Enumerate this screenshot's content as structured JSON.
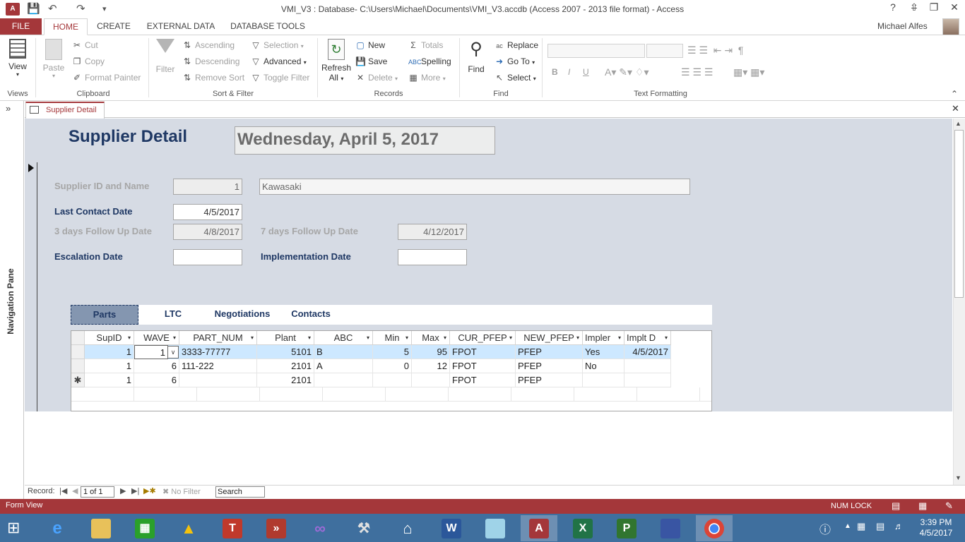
{
  "window": {
    "title": "VMI_V3 : Database- C:\\Users\\Michael\\Documents\\VMI_V3.accdb (Access 2007 - 2013 file format) - Access",
    "help": "?",
    "user": "Michael Alfes"
  },
  "tabs": {
    "file": "FILE",
    "home": "HOME",
    "create": "CREATE",
    "external": "EXTERNAL DATA",
    "dbtools": "DATABASE TOOLS"
  },
  "ribbon": {
    "views": {
      "view": "View",
      "label": "Views"
    },
    "clipboard": {
      "paste": "Paste",
      "cut": "Cut",
      "copy": "Copy",
      "format_painter": "Format Painter",
      "label": "Clipboard"
    },
    "sort_filter": {
      "filter": "Filter",
      "ascending": "Ascending",
      "descending": "Descending",
      "remove_sort": "Remove Sort",
      "selection": "Selection",
      "advanced": "Advanced",
      "toggle_filter": "Toggle Filter",
      "label": "Sort & Filter"
    },
    "records": {
      "refresh": "Refresh",
      "refresh_all": "All",
      "new": "New",
      "save": "Save",
      "delete": "Delete",
      "totals": "Totals",
      "spelling": "Spelling",
      "more": "More",
      "label": "Records"
    },
    "find": {
      "find": "Find",
      "replace": "Replace",
      "goto": "Go To",
      "select": "Select",
      "label": "Find"
    },
    "text_formatting": {
      "bold": "B",
      "italic": "I",
      "underline": "U",
      "label": "Text Formatting"
    }
  },
  "nav_pane": {
    "label": "Navigation Pane"
  },
  "document": {
    "tab": "Supplier Detail"
  },
  "form": {
    "title": "Supplier Detail",
    "date": "Wednesday, April 5, 2017",
    "supplier_label": "Supplier ID and Name",
    "supplier_id": "1",
    "supplier_name": "Kawasaki",
    "last_contact_label": "Last Contact Date",
    "last_contact": "4/5/2017",
    "followup3_label": "3 days Follow Up Date",
    "followup3": "4/8/2017",
    "followup7_label": "7 days Follow Up Date",
    "followup7": "4/12/2017",
    "escalation_label": "Escalation Date",
    "escalation": "",
    "implementation_label": "Implementation Date",
    "implementation": ""
  },
  "subtabs": [
    "Parts",
    "LTC",
    "Negotiations",
    "Contacts"
  ],
  "grid": {
    "headers": [
      "SupID",
      "WAVE",
      "PART_NUM",
      "Plant",
      "ABC",
      "Min",
      "Max",
      "CUR_PFEP",
      "NEW_PFEP",
      "Impler",
      "Implt D"
    ],
    "rows": [
      [
        "1",
        "1",
        "3333-77777",
        "5101",
        "B",
        "5",
        "95",
        "FPOT",
        "PFEP",
        "Yes",
        "4/5/2017"
      ],
      [
        "1",
        "6",
        "111-222",
        "2101",
        "A",
        "0",
        "12",
        "FPOT",
        "PFEP",
        "No",
        ""
      ],
      [
        "1",
        "6",
        "",
        "2101",
        "",
        "",
        "",
        "FPOT",
        "PFEP",
        "",
        ""
      ]
    ],
    "new_row_marker": "✱"
  },
  "record_nav": {
    "label": "Record:",
    "position": "1 of 1",
    "filter": "No Filter",
    "search": "Search"
  },
  "status": {
    "left": "Form View",
    "numlock": "NUM LOCK"
  },
  "clock": {
    "time": "3:39 PM",
    "date": "4/5/2017"
  },
  "colors": {
    "access_red": "#a4373a",
    "form_bg": "#d6dbe4",
    "title_navy": "#1f3864",
    "selected_row": "#cde8ff"
  }
}
